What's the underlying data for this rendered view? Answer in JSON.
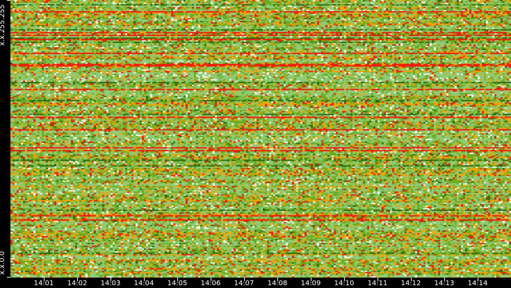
{
  "chart_data": {
    "type": "heatmap",
    "title": "",
    "xlabel": "",
    "ylabel": "",
    "x_ticks": [
      "14:01",
      "14:02",
      "14:03",
      "14:04",
      "14:05",
      "14:06",
      "14:07",
      "14:08",
      "14:09",
      "14:10",
      "14:11",
      "14:12",
      "14:13",
      "14:14"
    ],
    "x_range_minutes": [
      0,
      15
    ],
    "y_labels": {
      "top": "x.x.255.255",
      "bottom": "x.x.0.0"
    },
    "columns": 240,
    "rows": 200,
    "color_scale": {
      "white": "#f4f8f0",
      "light_green": "#8fcb78",
      "green": "#6aad1f",
      "dark_green": "#2f6a12",
      "orange": "#f2a300",
      "red": "#f21c0c"
    }
  }
}
